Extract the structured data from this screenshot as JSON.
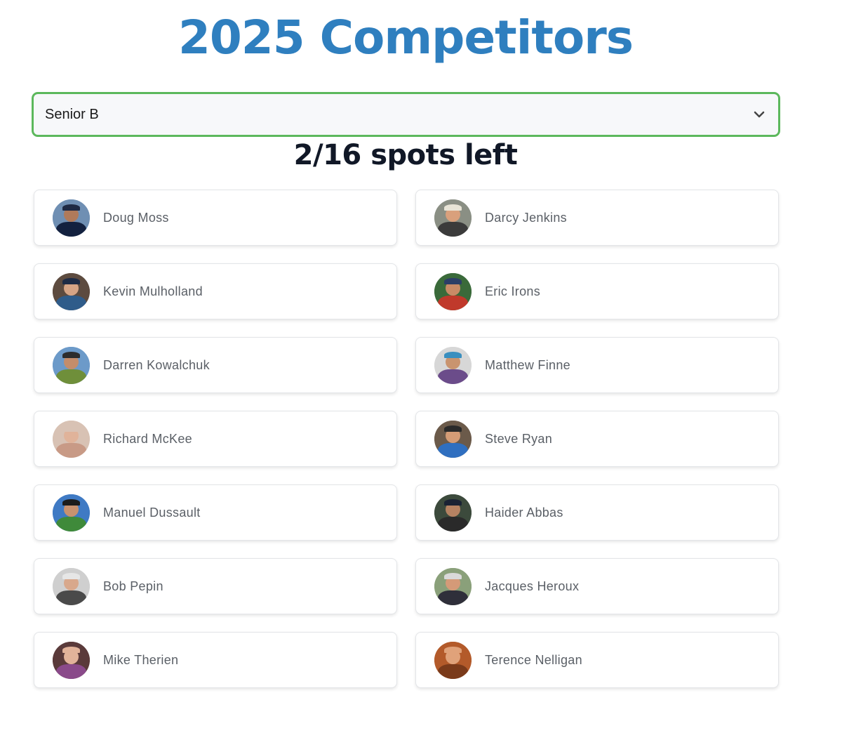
{
  "title": "2025 Competitors",
  "division_select": {
    "value": "Senior B"
  },
  "spots_text": "2/16 spots left",
  "competitors": [
    {
      "name": "Doug Moss",
      "avatar": {
        "sky": "#6f8fb3",
        "face": "#b07a5a",
        "cap": "#1f2a44",
        "shirt": "#13213f"
      }
    },
    {
      "name": "Darcy Jenkins",
      "avatar": {
        "sky": "#8a8f84",
        "face": "#d9a07c",
        "cap": "#e8e4d6",
        "shirt": "#3b3b3b"
      }
    },
    {
      "name": "Kevin Mulholland",
      "avatar": {
        "sky": "#5d4b3f",
        "face": "#d6a485",
        "cap": "#1e2b45",
        "shirt": "#2f5c8a"
      }
    },
    {
      "name": "Eric Irons",
      "avatar": {
        "sky": "#3a6a3a",
        "face": "#c98a66",
        "cap": "#2c3e66",
        "shirt": "#c0392b"
      }
    },
    {
      "name": "Darren Kowalchuk",
      "avatar": {
        "sky": "#6c9ac9",
        "face": "#c48d6b",
        "cap": "#2d2d2d",
        "shirt": "#6f8f3a"
      }
    },
    {
      "name": "Matthew Finne",
      "avatar": {
        "sky": "#d7d7d7",
        "face": "#c9946f",
        "cap": "#3a8fbf",
        "shirt": "#6b4c8a"
      }
    },
    {
      "name": "Richard McKee",
      "avatar": {
        "sky": "#d8c2b4",
        "face": "#e0b39a",
        "cap": "#d8c2b4",
        "shirt": "#c89a86"
      }
    },
    {
      "name": "Steve Ryan",
      "avatar": {
        "sky": "#6b5a4a",
        "face": "#d49c76",
        "cap": "#2a2a2a",
        "shirt": "#2f6fc0"
      }
    },
    {
      "name": "Manuel Dussault",
      "avatar": {
        "sky": "#3f7ac4",
        "face": "#c8926f",
        "cap": "#1c1c1c",
        "shirt": "#3f8a3a"
      }
    },
    {
      "name": "Haider Abbas",
      "avatar": {
        "sky": "#3c4a3c",
        "face": "#b58262",
        "cap": "#1a2233",
        "shirt": "#2a2a2a"
      }
    },
    {
      "name": "Bob Pepin",
      "avatar": {
        "sky": "#cfcfcf",
        "face": "#d8a88c",
        "cap": "#e6e6e6",
        "shirt": "#4a4a4a"
      }
    },
    {
      "name": "Jacques Heroux",
      "avatar": {
        "sky": "#8aa07a",
        "face": "#d49a78",
        "cap": "#d9d9d9",
        "shirt": "#2f2f3a"
      }
    },
    {
      "name": "Mike Therien",
      "avatar": {
        "sky": "#5a3a3a",
        "face": "#e2b39a",
        "cap": "#e2b39a",
        "shirt": "#8a4a8a"
      }
    },
    {
      "name": "Terence Nelligan",
      "avatar": {
        "sky": "#b35a2a",
        "face": "#e0a27a",
        "cap": "#e0a27a",
        "shirt": "#7a3a1a"
      }
    }
  ],
  "colors": {
    "title": "#2f7fbf",
    "select_border": "#5cb85c"
  },
  "icons": {
    "select_chevron": "chevron-down-icon"
  }
}
